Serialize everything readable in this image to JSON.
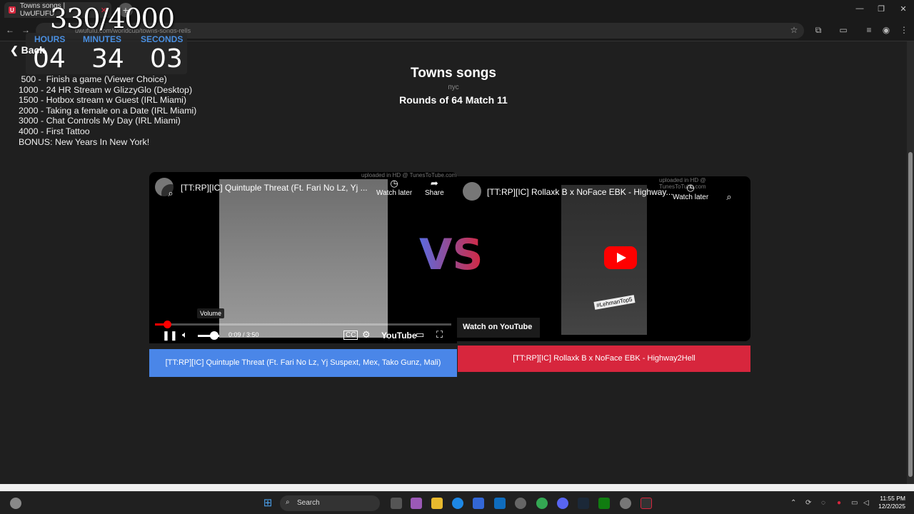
{
  "browser": {
    "tab_title": "Towns songs | UwUFUFU",
    "tab_close": "✕",
    "new_tab": "+",
    "url": "uwufufu.com/worldcup/towns-songs-rells",
    "window": {
      "minimize": "—",
      "restore": "❐",
      "close": "✕"
    }
  },
  "overlay": {
    "goal": "330/4000",
    "timer": {
      "hours_label": "HOURS",
      "minutes_label": "MINUTES",
      "seconds_label": "SECONDS",
      "hours": "04",
      "minutes": "34",
      "seconds": "03"
    },
    "goals": [
      " 500 -  Finish a game (Viewer Choice)",
      "1000 - 24 HR Stream w GlizzyGlo (Desktop)",
      "1500 - Hotbox stream w Guest (IRL Miami)",
      "2000 - Taking a female on a Date (IRL Miami)",
      "3000 - Chat Controls My Day (IRL Miami)",
      "4000 - First Tattoo",
      "BONUS: New Years In New York!"
    ]
  },
  "page": {
    "back": "Back",
    "title": "Towns songs",
    "subtitle": "пус",
    "round": "Rounds of 64 Match 11",
    "vs": "VS"
  },
  "video_left": {
    "title": "[TT:RP][IC] Quintuple Threat (Ft. Fari No Lz, Yj ...",
    "uploaded": "uploaded in HD @ TunesToTube.com",
    "watch_later": "Watch later",
    "share": "Share",
    "time": "0:09 / 3:50",
    "volume_tip": "Volume",
    "progress_fraction": 0.04,
    "youtube": "YouTube",
    "vote_label": "[TT:RP][IC] Quintuple Threat (Ft. Fari No Lz, Yj Suspext, Mex, Tako Gunz, Mali)"
  },
  "video_right": {
    "title": "[TT:RP][IC] Rollaxk B x NoFace EBK - Highway...",
    "uploaded": "uploaded in HD @ TunesToTube.com",
    "watch_later": "Watch later",
    "watch_on": "Watch on",
    "youtube": "YouTube",
    "sticker": "#LehmanTop5",
    "vote_label": "[TT:RP][IC] Rollaxk B x NoFace EBK - Highway2Hell"
  },
  "taskbar": {
    "search": "Search",
    "time": "11:55 PM",
    "date": "12/2/2025"
  },
  "colors": {
    "accent_blue": "#4a86e8",
    "accent_red": "#d7263d",
    "timer_label": "#4a8fe0"
  }
}
